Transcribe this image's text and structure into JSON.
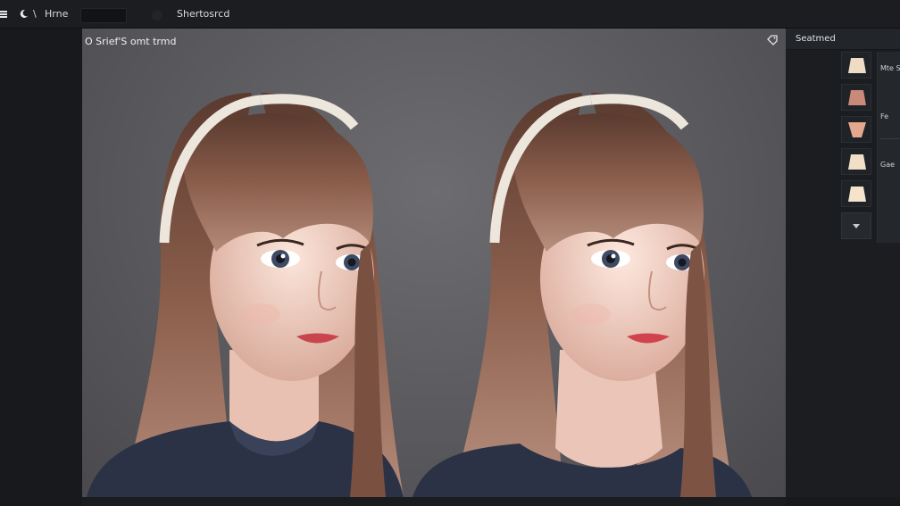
{
  "topbar": {
    "glyph": "\\",
    "menu_label": "Hrne",
    "document_title": "Shertosrcd",
    "icons": [
      "menu-icon",
      "moon-icon",
      "dot-icon"
    ]
  },
  "canvas": {
    "title": "O Srief'S omt trmd",
    "corner_icon": "tag-icon",
    "background_color": "#5c5b5f"
  },
  "panel": {
    "title": "Seatmed",
    "swatches": [
      {
        "name": "swatch-light",
        "color": "#f0dcc4"
      },
      {
        "name": "swatch-rose",
        "color": "#c98a7a"
      },
      {
        "name": "swatch-peach",
        "color": "#e4a88f"
      },
      {
        "name": "swatch-cream",
        "color": "#f2dfc7"
      },
      {
        "name": "swatch-ivory",
        "color": "#f5e3cc"
      }
    ],
    "side_labels": [
      "Mte S",
      "Fe",
      "Gae"
    ]
  },
  "colors": {
    "hair": "#6b4636",
    "skin": "#f1d2c4",
    "sweater": "#2c3346",
    "headband": "#ede6dc",
    "lips": "#c8454d"
  }
}
